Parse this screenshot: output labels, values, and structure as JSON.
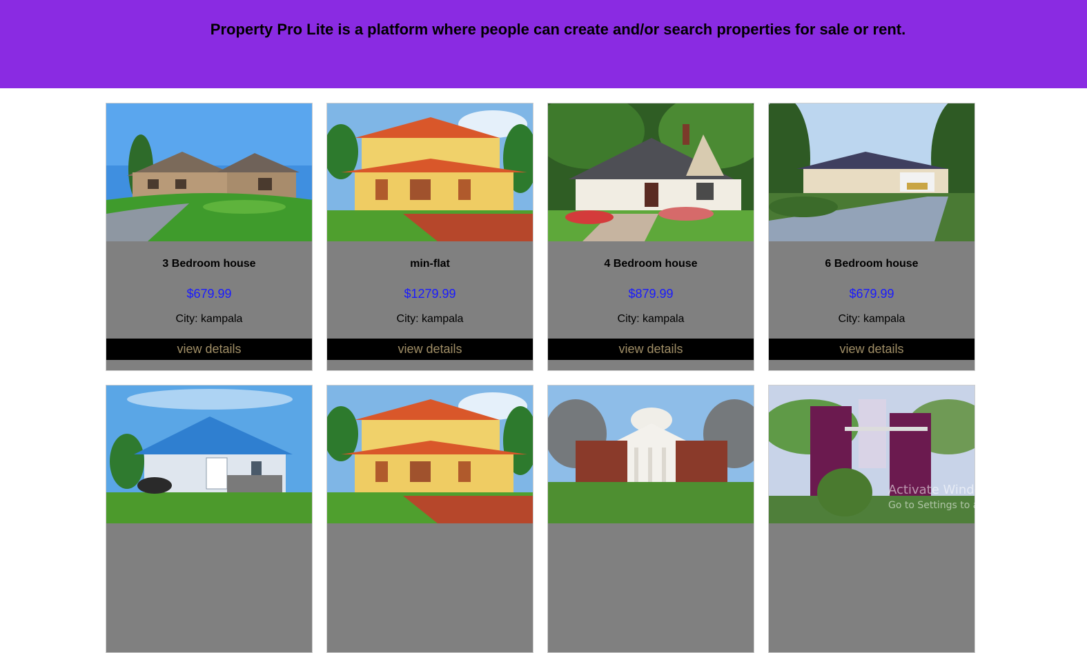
{
  "header": {
    "tagline": "Property Pro Lite is a platform where people can create and/or search properties for sale or rent.",
    "background": "#8a2be2"
  },
  "properties": [
    {
      "title": "3 Bedroom house",
      "price": "$679.99",
      "city": "City: kampala",
      "action": "view details",
      "scene": "suburban-house"
    },
    {
      "title": "min-flat",
      "price": "$1279.99",
      "city": "City: kampala",
      "action": "view details",
      "scene": "yellow-villa"
    },
    {
      "title": "4 Bedroom house",
      "price": "$879.99",
      "city": "City: kampala",
      "action": "view details",
      "scene": "porch-house"
    },
    {
      "title": "6 Bedroom house",
      "price": "$679.99",
      "city": "City: kampala",
      "action": "view details",
      "scene": "bungalow-driveway"
    },
    {
      "title": "",
      "price": "",
      "city": "",
      "action": "",
      "scene": "blue-roof-bungalow"
    },
    {
      "title": "",
      "price": "",
      "city": "",
      "action": "",
      "scene": "yellow-villa"
    },
    {
      "title": "",
      "price": "",
      "city": "",
      "action": "",
      "scene": "brick-mansion"
    },
    {
      "title": "",
      "price": "",
      "city": "",
      "action": "",
      "scene": "purple-modern-house"
    }
  ],
  "colors": {
    "card": "#808080",
    "price": "#1a1aff",
    "button": "#000000",
    "button_text": "#a08e66"
  },
  "watermark": {
    "line1": "Activate Windows",
    "line2": "Go to Settings to activate Windows."
  }
}
